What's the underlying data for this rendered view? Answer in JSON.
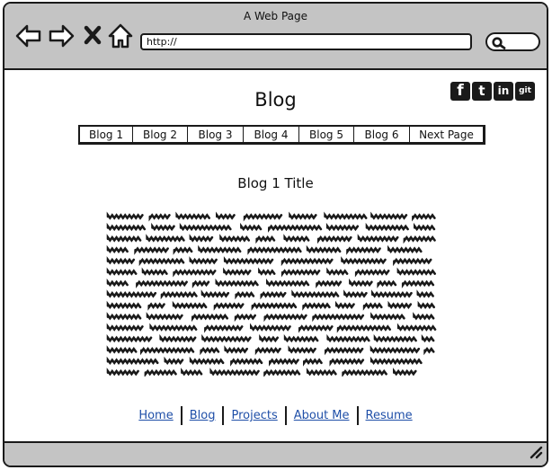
{
  "window": {
    "title": "A Web Page"
  },
  "browser": {
    "url": "http://",
    "nav_icons": [
      "back-arrow-icon",
      "forward-arrow-icon",
      "close-x-icon",
      "home-icon"
    ],
    "search_icon": "magnifier-icon"
  },
  "social": [
    {
      "name": "facebook-icon",
      "glyph": "f"
    },
    {
      "name": "twitter-icon",
      "glyph": "t"
    },
    {
      "name": "linkedin-icon",
      "glyph": "in"
    },
    {
      "name": "git-icon",
      "glyph": "git"
    }
  ],
  "page": {
    "title": "Blog"
  },
  "tabs": [
    {
      "label": "Blog 1",
      "active": true
    },
    {
      "label": "Blog 2",
      "active": false
    },
    {
      "label": "Blog 3",
      "active": false
    },
    {
      "label": "Blog 4",
      "active": false
    },
    {
      "label": "Blog 5",
      "active": false
    },
    {
      "label": "Blog 6",
      "active": false
    },
    {
      "label": "Next Page",
      "active": false
    }
  ],
  "post": {
    "title": "Blog 1 Title"
  },
  "footer": {
    "links": [
      "Home",
      "Blog",
      "Projects",
      "About Me",
      "Resume"
    ]
  },
  "colors": {
    "active_tab": "#a7c6f0",
    "link": "#1f4fa8",
    "chrome": "#c4c4c4"
  }
}
